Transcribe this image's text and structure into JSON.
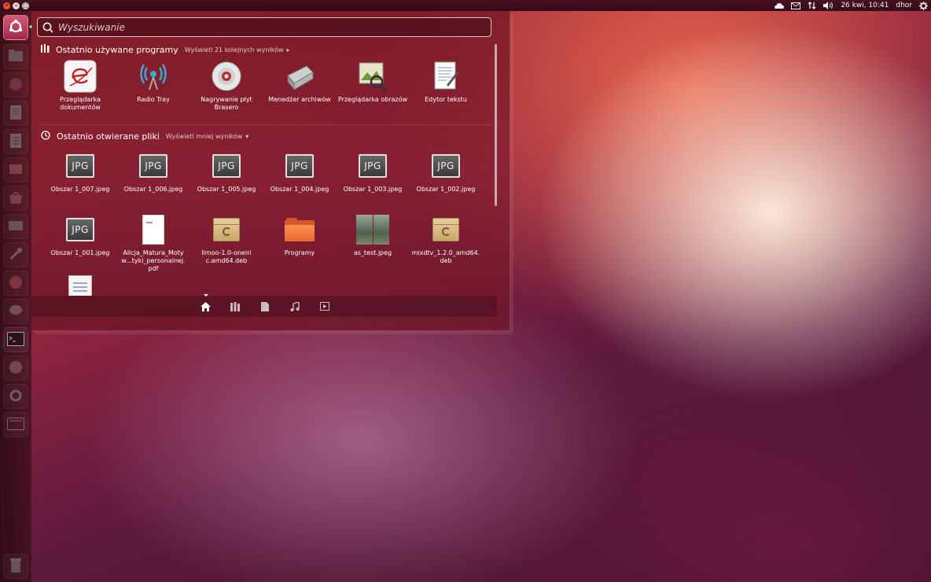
{
  "top_panel": {
    "date_time": "26 kwi, 10:41",
    "user": "dhor",
    "tray_icons": [
      "dropbox-icon",
      "mail-icon",
      "network-icon",
      "volume-icon",
      "session-gear-icon"
    ]
  },
  "launcher": {
    "items": [
      "dash-home-icon",
      "files-icon",
      "firefox-icon",
      "writer-icon",
      "calc-icon",
      "impress-icon",
      "software-center-icon",
      "drive-icon",
      "system-settings-icon",
      "audio-app-icon",
      "chat-icon",
      "terminal-icon",
      "pidgin-icon",
      "gear-settings-icon",
      "workspaces-icon",
      "trash-icon"
    ]
  },
  "dash": {
    "search_placeholder": "Wyszukiwanie",
    "apps_section": {
      "title": "Ostatnio używane programy",
      "more": "Wyświetl 21 kolejnych wyników",
      "items": [
        {
          "label": "Przeglądarka dokumentów"
        },
        {
          "label": "Radio Tray"
        },
        {
          "label": "Nagrywanie płyt Brasero"
        },
        {
          "label": "Menedżer archiwów"
        },
        {
          "label": "Przeglądarka obrazów"
        },
        {
          "label": "Edytor tekstu"
        }
      ]
    },
    "files_section": {
      "title": "Ostatnio otwierane pliki",
      "more": "Wyświetl mniej wyników",
      "jpg_label": "JPG",
      "items": [
        {
          "label": "Obszar 1_007.jpeg"
        },
        {
          "label": "Obszar 1_006.jpeg"
        },
        {
          "label": "Obszar 1_005.jpeg"
        },
        {
          "label": "Obszar 1_004.jpeg"
        },
        {
          "label": "Obszar 1_003.jpeg"
        },
        {
          "label": "Obszar 1_002.jpeg"
        },
        {
          "label": "Obszar 1_001.jpeg"
        },
        {
          "label": "Alicja_Matura_Motyw...tyki_personalnej.pdf"
        },
        {
          "label": "limoo-1.0-oneiric.amd64.deb"
        },
        {
          "label": "Programy"
        },
        {
          "label": "as_test.jpeg"
        },
        {
          "label": "mixdtv_1.2.0_amd64.deb"
        }
      ]
    },
    "lenses": [
      "home-lens-icon",
      "applications-lens-icon",
      "files-lens-icon",
      "music-lens-icon",
      "video-lens-icon"
    ]
  },
  "colors": {
    "accent": "#a2284b",
    "dash_tint": "#7a1826",
    "panel": "#33091a"
  }
}
